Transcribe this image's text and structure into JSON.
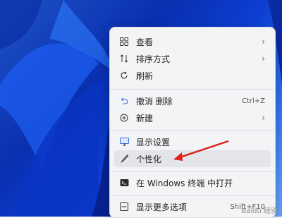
{
  "menu": {
    "items": [
      {
        "label": "查看",
        "icon": "grid-icon",
        "submenu": true
      },
      {
        "label": "排序方式",
        "icon": "sort-icon",
        "submenu": true
      },
      {
        "label": "刷新",
        "icon": "refresh-icon"
      },
      {
        "label": "撤消 删除",
        "icon": "undo-icon",
        "shortcut": "Ctrl+Z"
      },
      {
        "label": "新建",
        "icon": "new-icon",
        "submenu": true
      },
      {
        "label": "显示设置",
        "icon": "display-icon"
      },
      {
        "label": "个性化",
        "icon": "brush-icon"
      },
      {
        "label": "在 Windows 终端 中打开",
        "icon": "terminal-icon"
      },
      {
        "label": "显示更多选项",
        "icon": "more-options-icon",
        "shortcut": "Shift+F10"
      }
    ]
  },
  "watermark": "Baidu 经验",
  "colors": {
    "accent": "#e0201a",
    "menu_bg": "#f3f4f6"
  }
}
